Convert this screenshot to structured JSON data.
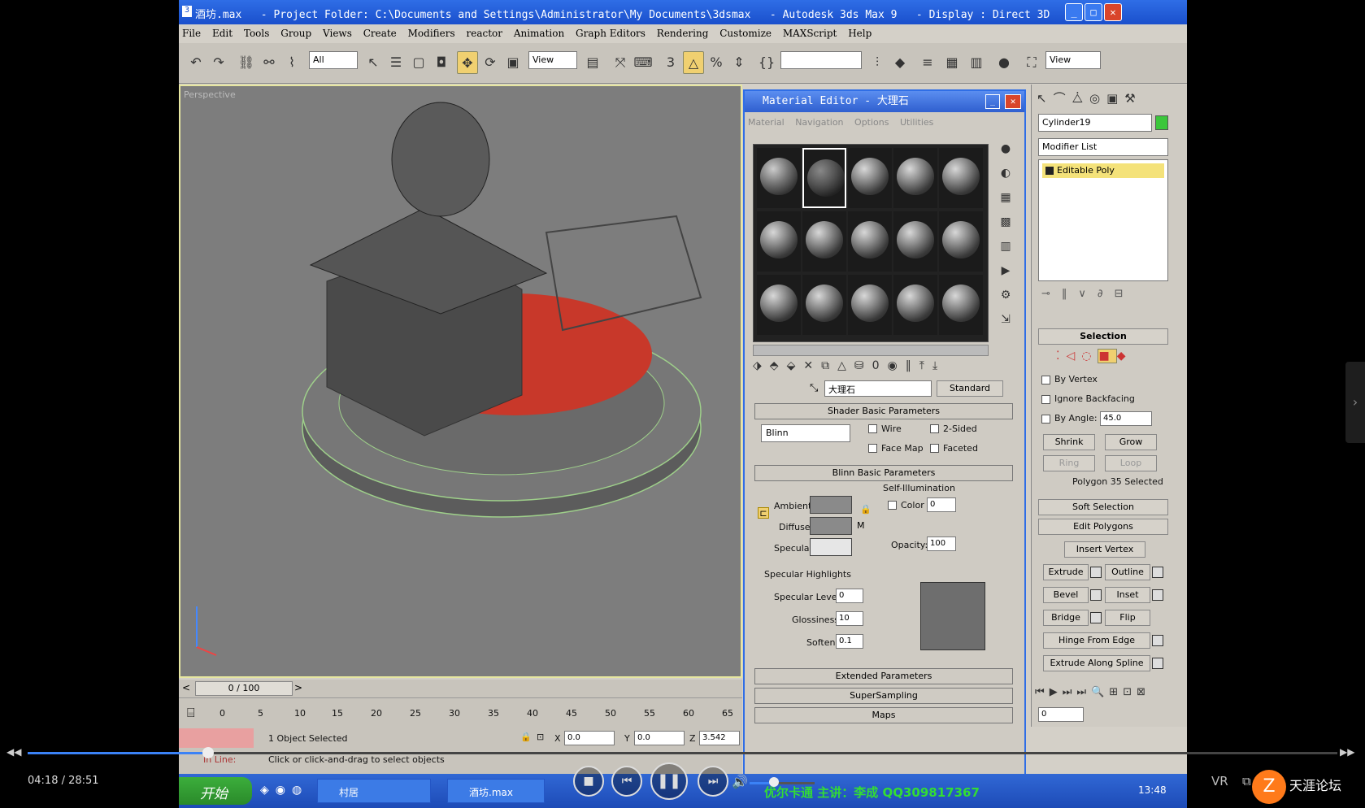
{
  "window": {
    "title": "酒坊.max   - Project Folder: C:\\Documents and Settings\\Administrator\\My Documents\\3dsmax   - Autodesk 3ds Max 9   - Display : Direct 3D"
  },
  "menu": [
    "File",
    "Edit",
    "Tools",
    "Group",
    "Views",
    "Create",
    "Modifiers",
    "reactor",
    "Animation",
    "Graph Editors",
    "Rendering",
    "Customize",
    "MAXScript",
    "Help"
  ],
  "toolbar": {
    "selection_filter": "All",
    "ref_coord": "View",
    "named_sel": "",
    "view2": "View"
  },
  "viewport": {
    "label": "Perspective"
  },
  "timeline": {
    "frame_counter": "0 / 100",
    "ticks": [
      "0",
      "5",
      "10",
      "15",
      "20",
      "25",
      "30",
      "35",
      "40",
      "45",
      "50",
      "55",
      "60",
      "65"
    ]
  },
  "status": {
    "selected": "1 Object Selected",
    "x": "0.0",
    "y": "0.0",
    "z": "3.542",
    "in_line": "In Line:",
    "prompt": "Click or click-and-drag to select objects"
  },
  "material_editor": {
    "title": "Material Editor - 大理石",
    "menu": [
      "Material",
      "Navigation",
      "Options",
      "Utilities"
    ],
    "material_name": "大理石",
    "type_button": "Standard",
    "shader_rollout": "Shader Basic Parameters",
    "shader": "Blinn",
    "wire": "Wire",
    "two_sided": "2-Sided",
    "face_map": "Face Map",
    "faceted": "Faceted",
    "blinn_rollout": "Blinn Basic Parameters",
    "self_illum": "Self-Illumination",
    "color_label": "Color",
    "color_value": "0",
    "ambient": "Ambient:",
    "diffuse": "Diffuse:",
    "specular": "Specular:",
    "opacity_label": "Opacity:",
    "opacity_value": "100",
    "spec_highlights": "Specular Highlights",
    "spec_level_label": "Specular Level:",
    "spec_level": "0",
    "glossiness_label": "Glossiness:",
    "glossiness": "10",
    "soften_label": "Soften:",
    "soften": "0.1",
    "extended": "Extended Parameters",
    "supersampling": "SuperSampling",
    "maps": "Maps",
    "ambient_color": "#8a8a8a",
    "diffuse_color": "#8a8a8a",
    "specular_color": "#e6e6e6"
  },
  "command_panel": {
    "object_name": "Cylinder19",
    "modifier_list": "Modifier List",
    "stack_item": "Editable Poly",
    "selection_rollout": "Selection",
    "by_vertex": "By Vertex",
    "ignore_backfacing": "Ignore Backfacing",
    "by_angle": "By Angle:",
    "by_angle_value": "45.0",
    "shrink": "Shrink",
    "grow": "Grow",
    "ring": "Ring",
    "loop": "Loop",
    "sel_status": "Polygon 35 Selected",
    "soft_selection": "Soft Selection",
    "edit_polygons": "Edit Polygons",
    "insert_vertex": "Insert Vertex",
    "extrude": "Extrude",
    "outline": "Outline",
    "bevel": "Bevel",
    "inset": "Inset",
    "bridge": "Bridge",
    "flip": "Flip",
    "hinge": "Hinge From Edge",
    "extrude_spline": "Extrude Along Spline",
    "frame_field": "0"
  },
  "taskbar": {
    "start": "开始",
    "tasks": [
      "村居",
      "酒坊.max"
    ],
    "scrolling_text": "优尔卡通 主讲：李成 QQ309817367",
    "clock": "13:48"
  },
  "player": {
    "time": "04:18 / 28:51",
    "progress": 0.138,
    "volume": 0.38,
    "vr": "VR",
    "brand": "天涯论坛"
  }
}
